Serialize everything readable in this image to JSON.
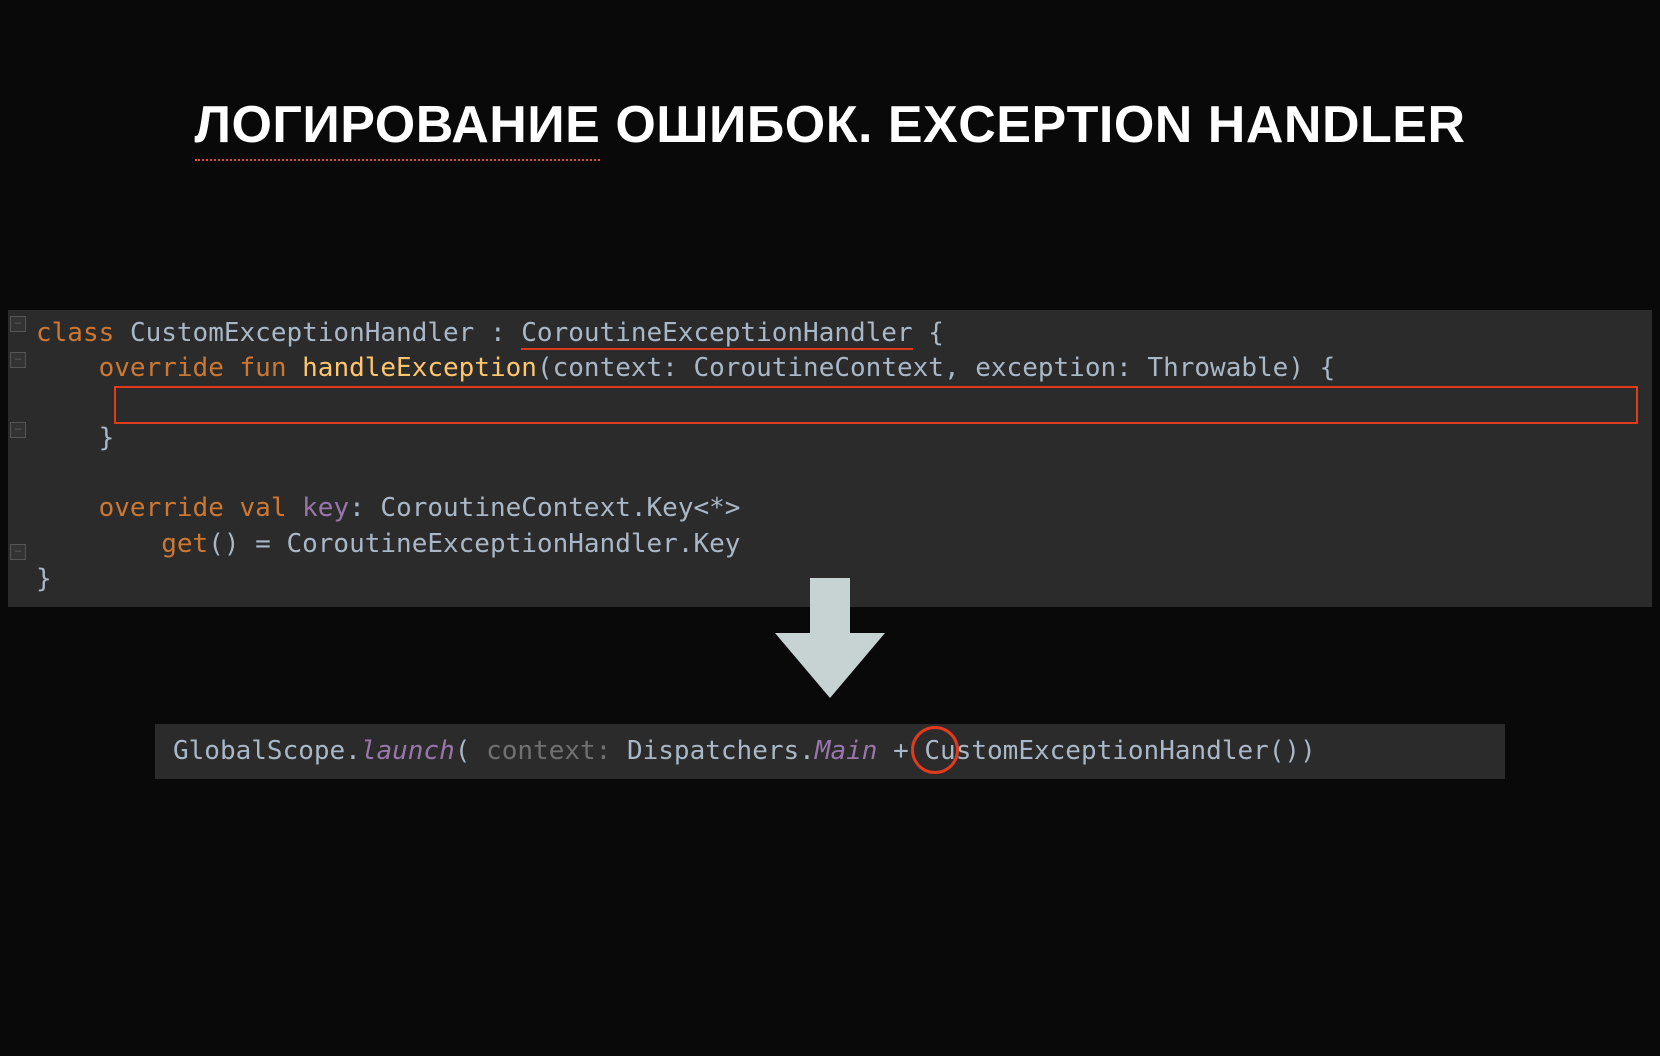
{
  "title": {
    "underlined": "ЛОГИРОВАНИЕ",
    "rest": " ОШИБОК. EXCEPTION HANDLER"
  },
  "code1": {
    "l1": {
      "a": "class",
      "b": "CustomExceptionHandler",
      "c": ":",
      "d": "CoroutineExceptionHandler",
      "e": "{"
    },
    "l2": {
      "a": "override",
      "b": "fun",
      "c": "handleException",
      "d": "(context: CoroutineContext, exception: Throwable) {"
    },
    "l4": {
      "a": "}"
    },
    "l6": {
      "a": "override",
      "b": "val",
      "c": "key",
      "d": ": CoroutineContext.Key<*>"
    },
    "l7": {
      "a": "get",
      "b": "() = CoroutineExceptionHandler.Key"
    },
    "l8": {
      "a": "}"
    }
  },
  "code2": {
    "a": "GlobalScope.",
    "b": "launch",
    "c": "(",
    "d": "context:",
    "e": "Dispatchers.",
    "f": "Main",
    "g": "+",
    "h": "CustomExceptionHandler())"
  }
}
